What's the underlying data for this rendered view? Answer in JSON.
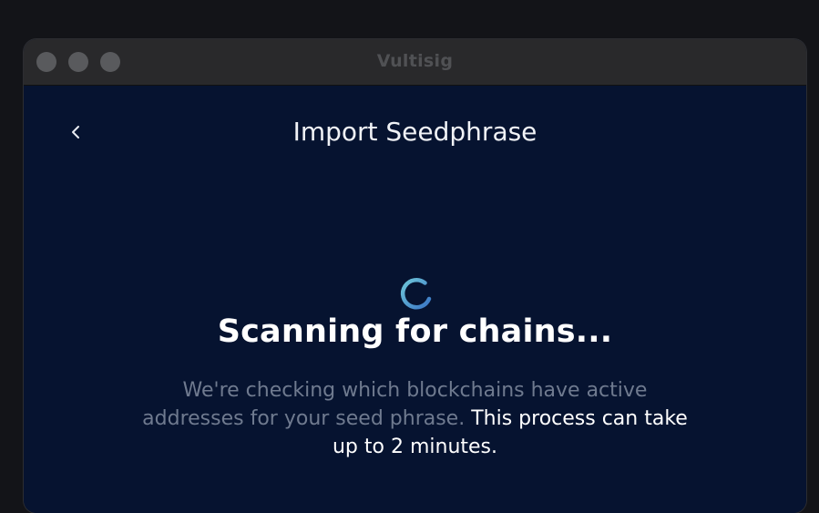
{
  "window": {
    "title": "Vultisig"
  },
  "header": {
    "title": "Import Seedphrase",
    "back_icon": "chevron-left-icon"
  },
  "main": {
    "spinner_icon": "loading-spinner-icon",
    "heading": "Scanning for chains...",
    "description_muted": "We're checking which blockchains have active addresses for your seed phrase.",
    "description_highlight": "This process can take up to 2 minutes."
  },
  "colors": {
    "background": "#061330",
    "titlebar": "#29292b",
    "spinner_start": "#5fb6d6",
    "spinner_end": "#3a78c4",
    "muted_text": "#6f7a8f",
    "text": "#ffffff"
  }
}
